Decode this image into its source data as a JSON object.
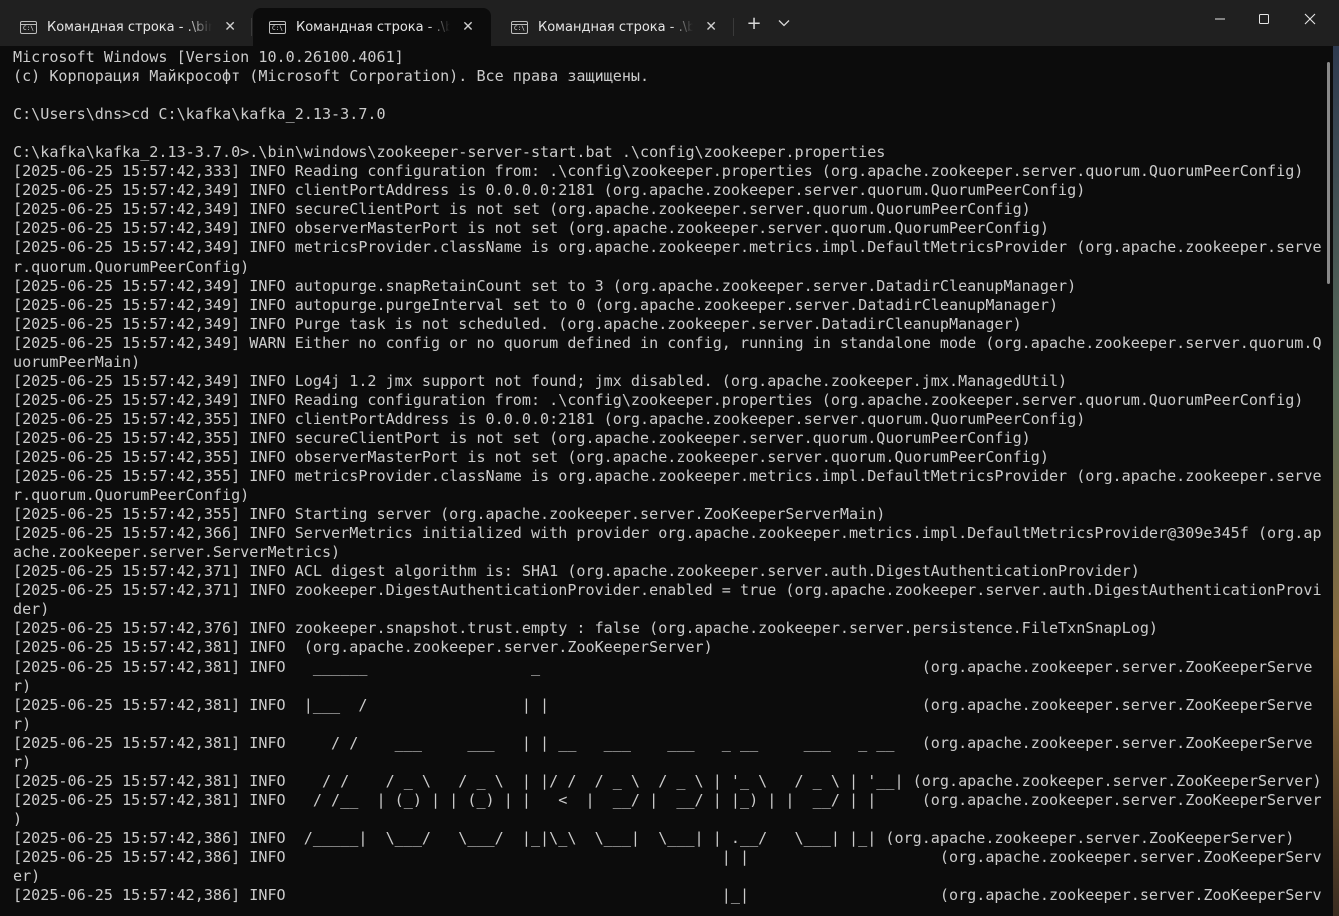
{
  "tabs": [
    {
      "title": "Командная строка - .\\bin\\windows\\zookeeper-server-start.bat",
      "icon": "cmd-icon",
      "active": false
    },
    {
      "title": "Командная строка - .\\bin\\windows\\zookeeper-server-start.bat",
      "icon": "cmd-icon",
      "active": true
    },
    {
      "title": "Командная строка - .\\bin\\windows\\zookeeper-server-start.bat",
      "icon": "cmd-icon",
      "active": false
    }
  ],
  "icons": {
    "cmd": "C:\\",
    "close": "✕",
    "new_tab": "+",
    "dropdown": "⌄",
    "minimize": "minimize-icon",
    "maximize": "maximize-icon",
    "window_close": "close-icon"
  },
  "terminal": {
    "lines": [
      "Microsoft Windows [Version 10.0.26100.4061]",
      "(c) Корпорация Майкрософт (Microsoft Corporation). Все права защищены.",
      "",
      "C:\\Users\\dns>cd C:\\kafka\\kafka_2.13-3.7.0",
      "",
      "C:\\kafka\\kafka_2.13-3.7.0>.\\bin\\windows\\zookeeper-server-start.bat .\\config\\zookeeper.properties",
      "[2025-06-25 15:57:42,333] INFO Reading configuration from: .\\config\\zookeeper.properties (org.apache.zookeeper.server.quorum.QuorumPeerConfig)",
      "[2025-06-25 15:57:42,349] INFO clientPortAddress is 0.0.0.0:2181 (org.apache.zookeeper.server.quorum.QuorumPeerConfig)",
      "[2025-06-25 15:57:42,349] INFO secureClientPort is not set (org.apache.zookeeper.server.quorum.QuorumPeerConfig)",
      "[2025-06-25 15:57:42,349] INFO observerMasterPort is not set (org.apache.zookeeper.server.quorum.QuorumPeerConfig)",
      "[2025-06-25 15:57:42,349] INFO metricsProvider.className is org.apache.zookeeper.metrics.impl.DefaultMetricsProvider (org.apache.zookeeper.serve",
      "r.quorum.QuorumPeerConfig)",
      "[2025-06-25 15:57:42,349] INFO autopurge.snapRetainCount set to 3 (org.apache.zookeeper.server.DatadirCleanupManager)",
      "[2025-06-25 15:57:42,349] INFO autopurge.purgeInterval set to 0 (org.apache.zookeeper.server.DatadirCleanupManager)",
      "[2025-06-25 15:57:42,349] INFO Purge task is not scheduled. (org.apache.zookeeper.server.DatadirCleanupManager)",
      "[2025-06-25 15:57:42,349] WARN Either no config or no quorum defined in config, running in standalone mode (org.apache.zookeeper.server.quorum.Q",
      "uorumPeerMain)",
      "[2025-06-25 15:57:42,349] INFO Log4j 1.2 jmx support not found; jmx disabled. (org.apache.zookeeper.jmx.ManagedUtil)",
      "[2025-06-25 15:57:42,349] INFO Reading configuration from: .\\config\\zookeeper.properties (org.apache.zookeeper.server.quorum.QuorumPeerConfig)",
      "[2025-06-25 15:57:42,355] INFO clientPortAddress is 0.0.0.0:2181 (org.apache.zookeeper.server.quorum.QuorumPeerConfig)",
      "[2025-06-25 15:57:42,355] INFO secureClientPort is not set (org.apache.zookeeper.server.quorum.QuorumPeerConfig)",
      "[2025-06-25 15:57:42,355] INFO observerMasterPort is not set (org.apache.zookeeper.server.quorum.QuorumPeerConfig)",
      "[2025-06-25 15:57:42,355] INFO metricsProvider.className is org.apache.zookeeper.metrics.impl.DefaultMetricsProvider (org.apache.zookeeper.serve",
      "r.quorum.QuorumPeerConfig)",
      "[2025-06-25 15:57:42,355] INFO Starting server (org.apache.zookeeper.server.ZooKeeperServerMain)",
      "[2025-06-25 15:57:42,366] INFO ServerMetrics initialized with provider org.apache.zookeeper.metrics.impl.DefaultMetricsProvider@309e345f (org.ap",
      "ache.zookeeper.server.ServerMetrics)",
      "[2025-06-25 15:57:42,371] INFO ACL digest algorithm is: SHA1 (org.apache.zookeeper.server.auth.DigestAuthenticationProvider)",
      "[2025-06-25 15:57:42,371] INFO zookeeper.DigestAuthenticationProvider.enabled = true (org.apache.zookeeper.server.auth.DigestAuthenticationProvi",
      "der)",
      "[2025-06-25 15:57:42,376] INFO zookeeper.snapshot.trust.empty : false (org.apache.zookeeper.server.persistence.FileTxnSnapLog)",
      "[2025-06-25 15:57:42,381] INFO  (org.apache.zookeeper.server.ZooKeeperServer)",
      "[2025-06-25 15:57:42,381] INFO   ______                  _                                          (org.apache.zookeeper.server.ZooKeeperServe",
      "r)",
      "[2025-06-25 15:57:42,381] INFO  |___  /                 | |                                         (org.apache.zookeeper.server.ZooKeeperServe",
      "r)",
      "[2025-06-25 15:57:42,381] INFO     / /    ___     ___   | | __   ___    ___   _ __     ___   _ __   (org.apache.zookeeper.server.ZooKeeperServe",
      "r)",
      "[2025-06-25 15:57:42,381] INFO    / /    / _ \\   / _ \\  | |/ /  / _ \\  / _ \\ | '_ \\   / _ \\ | '__| (org.apache.zookeeper.server.ZooKeeperServer)",
      "[2025-06-25 15:57:42,381] INFO   / /__  | (_) | | (_) | |   <  |  __/ |  __/ | |_) | |  __/ | |     (org.apache.zookeeper.server.ZooKeeperServer",
      ")",
      "[2025-06-25 15:57:42,386] INFO  /_____|  \\___/   \\___/  |_|\\_\\  \\___|  \\___| | .__/   \\___| |_| (org.apache.zookeeper.server.ZooKeeperServer)",
      "[2025-06-25 15:57:42,386] INFO                                                | |                     (org.apache.zookeeper.server.ZooKeeperServ",
      "er)",
      "[2025-06-25 15:57:42,386] INFO                                                |_|                     (org.apache.zookeeper.server.ZooKeeperServ"
    ]
  }
}
